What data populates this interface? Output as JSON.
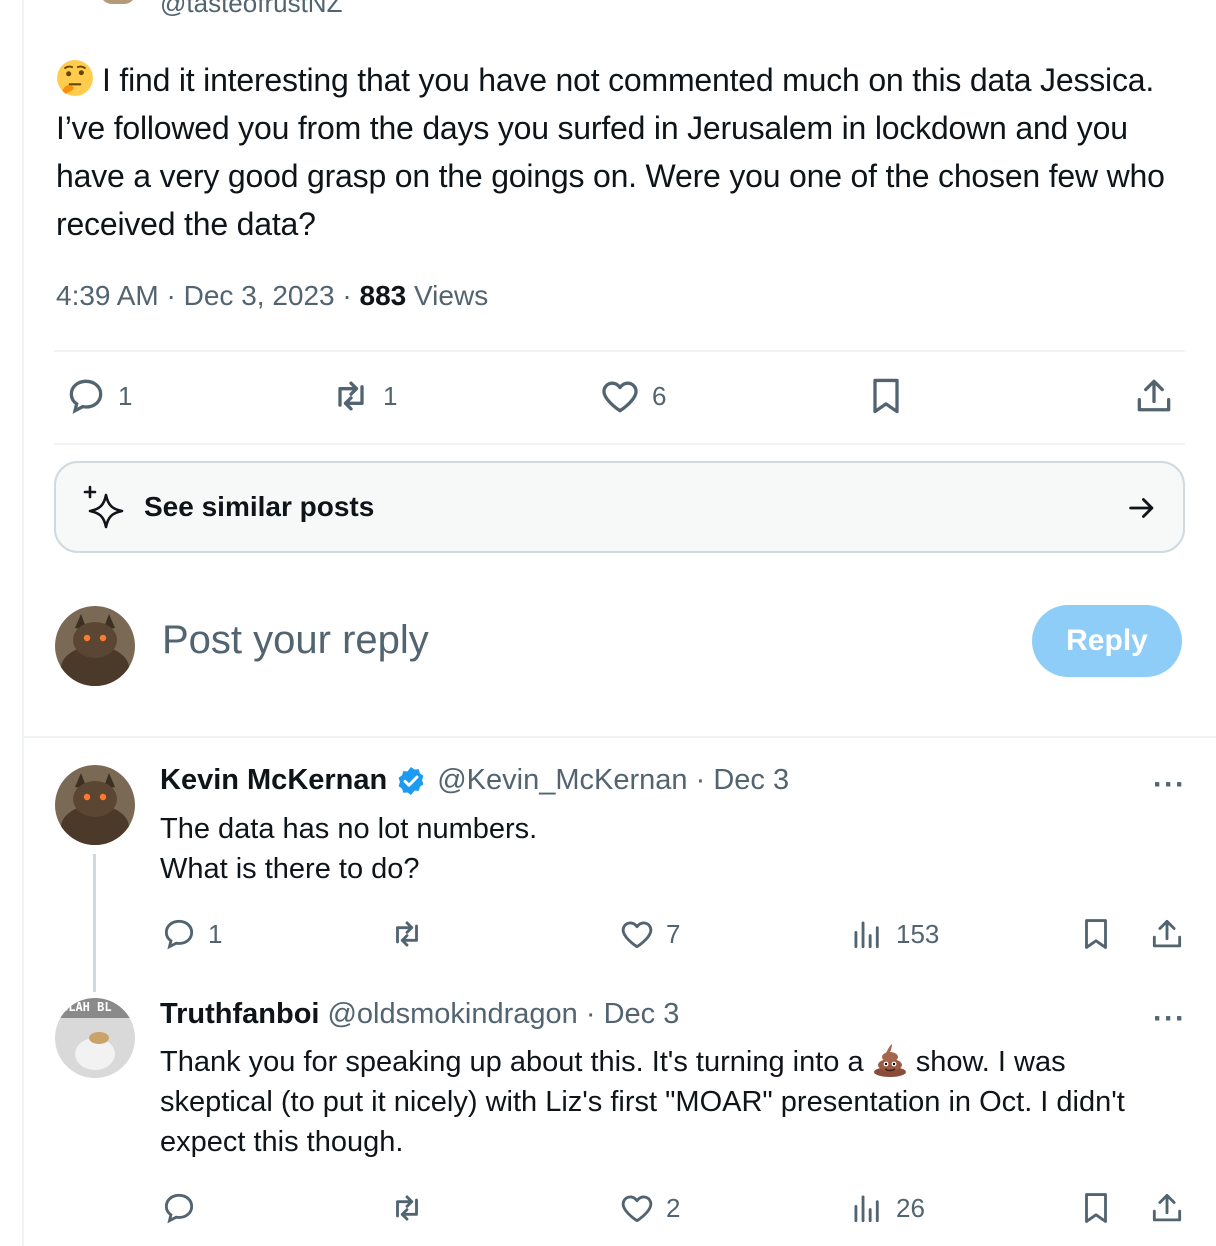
{
  "main_tweet": {
    "handle_partial": "@tasteofrustNZ",
    "text": "I find it interesting that you have not commented much on this data Jessica.  I’ve followed you from the days you surfed in Jerusalem in lockdown and you have a very good grasp on the goings on.  Were you one of the chosen few who received the data?",
    "emoji": "thinking-face",
    "time": "4:39 AM",
    "date": "Dec 3, 2023",
    "views_count": "883",
    "views_label": "Views",
    "sep": "·",
    "replies": "1",
    "reposts": "1",
    "likes": "6"
  },
  "similar": {
    "label": "See similar posts"
  },
  "compose": {
    "placeholder": "Post your reply",
    "button": "Reply"
  },
  "replies": [
    {
      "name": "Kevin McKernan",
      "handle": "@Kevin_McKernan",
      "date": "Dec 3",
      "sep": "·",
      "verified": true,
      "body_line1": "The data has no lot numbers.",
      "body_line2": "What is there to do?",
      "replies": "1",
      "reposts": "",
      "likes": "7",
      "views": "153",
      "more": "···"
    },
    {
      "name": "Truthfanboi",
      "handle": "@oldsmokindragon",
      "date": "Dec 3",
      "sep": "·",
      "verified": false,
      "avatar_text": "BLAH BL",
      "body_part1": "Thank you for speaking up about this.  It's turning into a ",
      "body_emoji": "pile-of-poo",
      "body_part2": " show. I was skeptical (to put it nicely) with Liz's first \"MOAR\" presentation in Oct. I didn't expect this though.",
      "replies": "",
      "reposts": "",
      "likes": "2",
      "views": "26",
      "more": "···"
    }
  ],
  "colors": {
    "accent": "#1d9bf0",
    "reply_button_disabled": "#8ecdf8",
    "secondary_text": "#536471"
  }
}
